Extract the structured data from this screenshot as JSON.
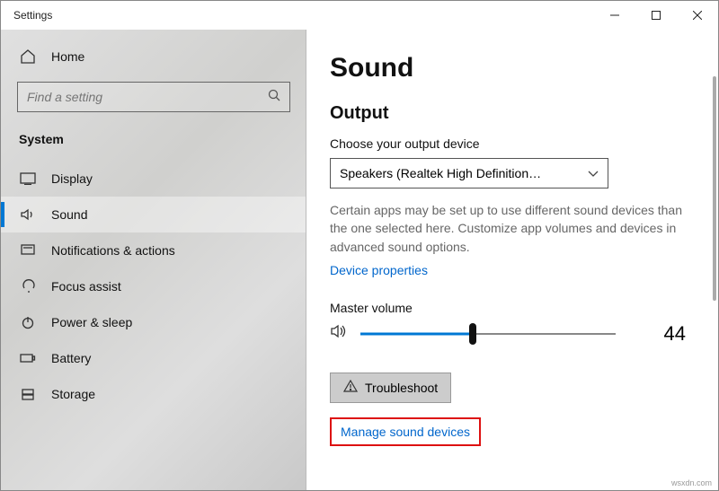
{
  "titlebar": {
    "title": "Settings"
  },
  "sidebar": {
    "home": "Home",
    "search_placeholder": "Find a setting",
    "group": "System",
    "items": [
      {
        "label": "Display"
      },
      {
        "label": "Sound"
      },
      {
        "label": "Notifications & actions"
      },
      {
        "label": "Focus assist"
      },
      {
        "label": "Power & sleep"
      },
      {
        "label": "Battery"
      },
      {
        "label": "Storage"
      }
    ]
  },
  "main": {
    "heading": "Sound",
    "output_heading": "Output",
    "choose_label": "Choose your output device",
    "selected_device": "Speakers (Realtek High Definition…",
    "desc": "Certain apps may be set up to use different sound devices than the one selected here. Customize app volumes and devices in advanced sound options.",
    "device_props": "Device properties",
    "master_volume_label": "Master volume",
    "volume_value": "44",
    "troubleshoot": "Troubleshoot",
    "manage": "Manage sound devices"
  },
  "watermark": "wsxdn.com"
}
